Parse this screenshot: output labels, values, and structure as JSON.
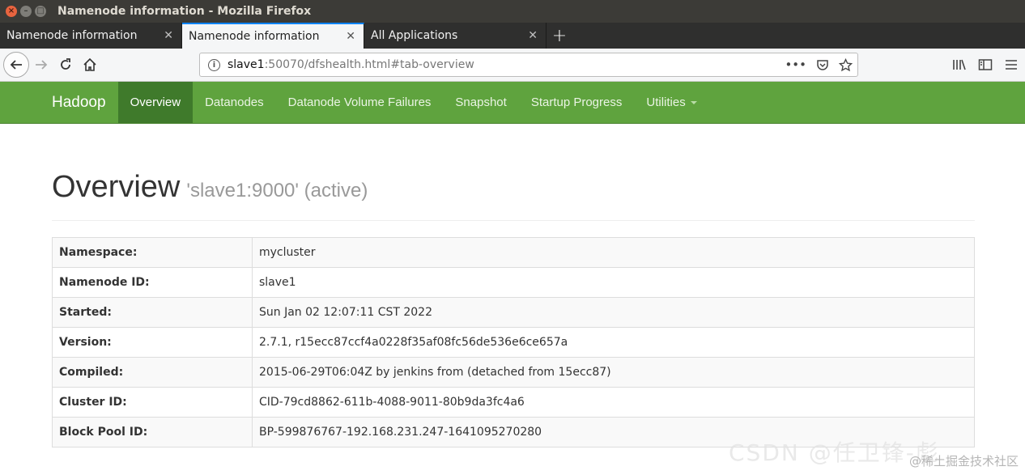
{
  "window": {
    "title": "Namenode information - Mozilla Firefox"
  },
  "tabs": [
    {
      "label": "Namenode information",
      "active": false
    },
    {
      "label": "Namenode information",
      "active": true
    },
    {
      "label": "All Applications",
      "active": false
    }
  ],
  "address_bar": {
    "host": "slave1",
    "rest": ":50070/dfshealth.html#tab-overview"
  },
  "colors": {
    "navbar": "#5fa33e",
    "navbar_active": "#3f7a2b",
    "tab_accent": "#0a84ff"
  },
  "hadoop_nav": {
    "brand": "Hadoop",
    "items": [
      {
        "label": "Overview",
        "active": true
      },
      {
        "label": "Datanodes"
      },
      {
        "label": "Datanode Volume Failures"
      },
      {
        "label": "Snapshot"
      },
      {
        "label": "Startup Progress"
      },
      {
        "label": "Utilities"
      }
    ]
  },
  "header": {
    "title": "Overview",
    "subtitle": "'slave1:9000' (active)"
  },
  "overview_table": [
    {
      "key": "Namespace:",
      "value": "mycluster"
    },
    {
      "key": "Namenode ID:",
      "value": "slave1"
    },
    {
      "key": "Started:",
      "value": "Sun Jan 02 12:07:11 CST 2022"
    },
    {
      "key": "Version:",
      "value": "2.7.1, r15ecc87ccf4a0228f35af08fc56de536e6ce657a"
    },
    {
      "key": "Compiled:",
      "value": "2015-06-29T06:04Z by jenkins from (detached from 15ecc87)"
    },
    {
      "key": "Cluster ID:",
      "value": "CID-79cd8862-611b-4088-9011-80b9da3fc4a6"
    },
    {
      "key": "Block Pool ID:",
      "value": "BP-599876767-192.168.231.247-1641095270280"
    }
  ],
  "watermark": "@稀土掘金技术社区",
  "watermark_ghost": "CSDN @任卫锋-彪"
}
